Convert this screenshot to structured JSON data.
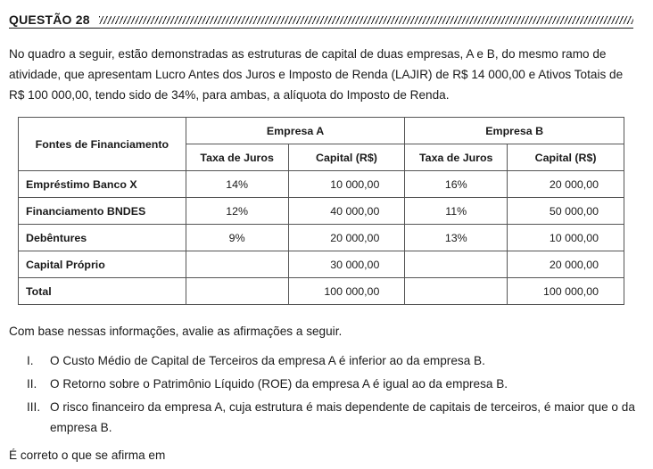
{
  "question": {
    "title": "QUESTÃO 28",
    "intro": "No quadro a seguir, estão demonstradas as estruturas de capital de duas empresas, A e B, do mesmo ramo de atividade, que apresentam Lucro Antes dos Juros e Imposto de Renda (LAJIR) de R$ 14 000,00 e Ativos Totais de R$ 100 000,00, tendo sido de 34%, para ambas, a alíquota do Imposto de Renda."
  },
  "table": {
    "row_header": "Fontes de Financiamento",
    "company_a": "Empresa A",
    "company_b": "Empresa B",
    "col_rate": "Taxa de Juros",
    "col_capital": "Capital (R$)",
    "rows": [
      {
        "source": "Empréstimo Banco X",
        "a_rate": "14%",
        "a_capital": "10 000,00",
        "b_rate": "16%",
        "b_capital": "20 000,00"
      },
      {
        "source": "Financiamento BNDES",
        "a_rate": "12%",
        "a_capital": "40 000,00",
        "b_rate": "11%",
        "b_capital": "50 000,00"
      },
      {
        "source": "Debêntures",
        "a_rate": "9%",
        "a_capital": "20 000,00",
        "b_rate": "13%",
        "b_capital": "10 000,00"
      },
      {
        "source": "Capital Próprio",
        "a_rate": "",
        "a_capital": "30 000,00",
        "b_rate": "",
        "b_capital": "20 000,00"
      },
      {
        "source": "Total",
        "a_rate": "",
        "a_capital": "100 000,00",
        "b_rate": "",
        "b_capital": "100 000,00"
      }
    ]
  },
  "prompt": "Com base nessas informações, avalie as afirmações a seguir.",
  "statements": [
    {
      "num": "I.",
      "text": "O Custo Médio de Capital de Terceiros da empresa A é inferior ao da empresa B."
    },
    {
      "num": "II.",
      "text": "O Retorno sobre o Patrimônio Líquido (ROE) da empresa A é igual ao da empresa B."
    },
    {
      "num": "III.",
      "text": "O risco financeiro da empresa A, cuja estrutura é mais dependente de capitais de terceiros, é maior que o da empresa B."
    }
  ],
  "closing": "É correto o que se afirma em"
}
